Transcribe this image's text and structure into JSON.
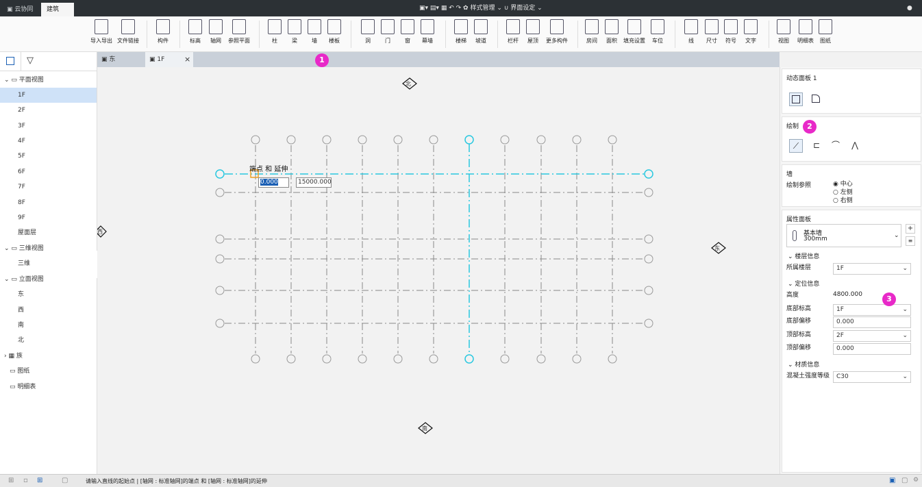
{
  "titlebar": {
    "tabs": [
      {
        "label": "云协同"
      },
      {
        "label": "建筑"
      }
    ],
    "menus": {
      "style": "样式管理",
      "ui": "界面设定"
    }
  },
  "ribbon": {
    "groups": [
      {
        "label": "导入导出"
      },
      {
        "label": "文件链接"
      },
      {
        "label": "构件"
      },
      {
        "label": "标高"
      },
      {
        "label": "轴网"
      },
      {
        "label": "参照平面"
      },
      {
        "label": "柱"
      },
      {
        "label": "梁"
      },
      {
        "label": "墙"
      },
      {
        "label": "楼板"
      },
      {
        "label": "洞"
      },
      {
        "label": "门"
      },
      {
        "label": "窗"
      },
      {
        "label": "幕墙"
      },
      {
        "label": "楼梯"
      },
      {
        "label": "坡道"
      },
      {
        "label": "栏杆"
      },
      {
        "label": "屋顶"
      },
      {
        "label": "更多构件"
      },
      {
        "label": "房间"
      },
      {
        "label": "面积"
      },
      {
        "label": "填充设置"
      },
      {
        "label": "车位"
      },
      {
        "label": "线"
      },
      {
        "label": "尺寸"
      },
      {
        "label": "符号"
      },
      {
        "label": "文字"
      },
      {
        "label": "视图"
      },
      {
        "label": "明细表"
      },
      {
        "label": "图纸"
      }
    ]
  },
  "tree": {
    "plan": "平面视图",
    "floors": [
      "1F",
      "2F",
      "3F",
      "4F",
      "5F",
      "6F",
      "7F",
      "8F",
      "9F",
      "屋面层"
    ],
    "view3d": "三维视图",
    "view3d_item": "三维",
    "elev": "立面视图",
    "elev_items": [
      "东",
      "西",
      "南",
      "北"
    ],
    "family": "族",
    "drawing": "图纸",
    "schedule": "明细表"
  },
  "doctabs": {
    "tab1": "东",
    "tab2": "1F"
  },
  "canvas": {
    "compass": {
      "north": "北",
      "south": "南",
      "east": "东",
      "west": "西"
    },
    "tooltip": "端点 和 延伸",
    "input1": "0.000",
    "input2": "15000.000"
  },
  "panel": {
    "dynamic_title": "动态面板 1",
    "draw_title": "绘制",
    "wall_title": "墙",
    "draw_ref": "绘制参照",
    "ref_options": [
      "中心",
      "左侧",
      "右侧"
    ],
    "prop_title": "属性面板",
    "type_name": "基本墙",
    "type_size": "300mm",
    "floor_info": "楼层信息",
    "floor_label": "所属楼层",
    "floor_value": "1F",
    "pos_info": "定位信息",
    "height_label": "高度",
    "height_value": "4800.000",
    "base_level_label": "底部标高",
    "base_level_value": "1F",
    "base_offset_label": "底部偏移",
    "base_offset_value": "0.000",
    "top_level_label": "顶部标高",
    "top_level_value": "2F",
    "top_offset_label": "顶部偏移",
    "top_offset_value": "0.000",
    "material_info": "材质信息",
    "concrete_label": "混凝土强度等级",
    "concrete_value": "C30"
  },
  "status": {
    "text": "请输入直线的起始点 | [轴网 : 标准轴网]的端点 和 [轴网 : 标准轴网]的延伸"
  },
  "badges": [
    "1",
    "2",
    "3"
  ],
  "colors": {
    "accent": "#29c8e0",
    "badge": "#e829c8",
    "selection": "#cfe2f8",
    "titlebar": "#2c3135"
  }
}
